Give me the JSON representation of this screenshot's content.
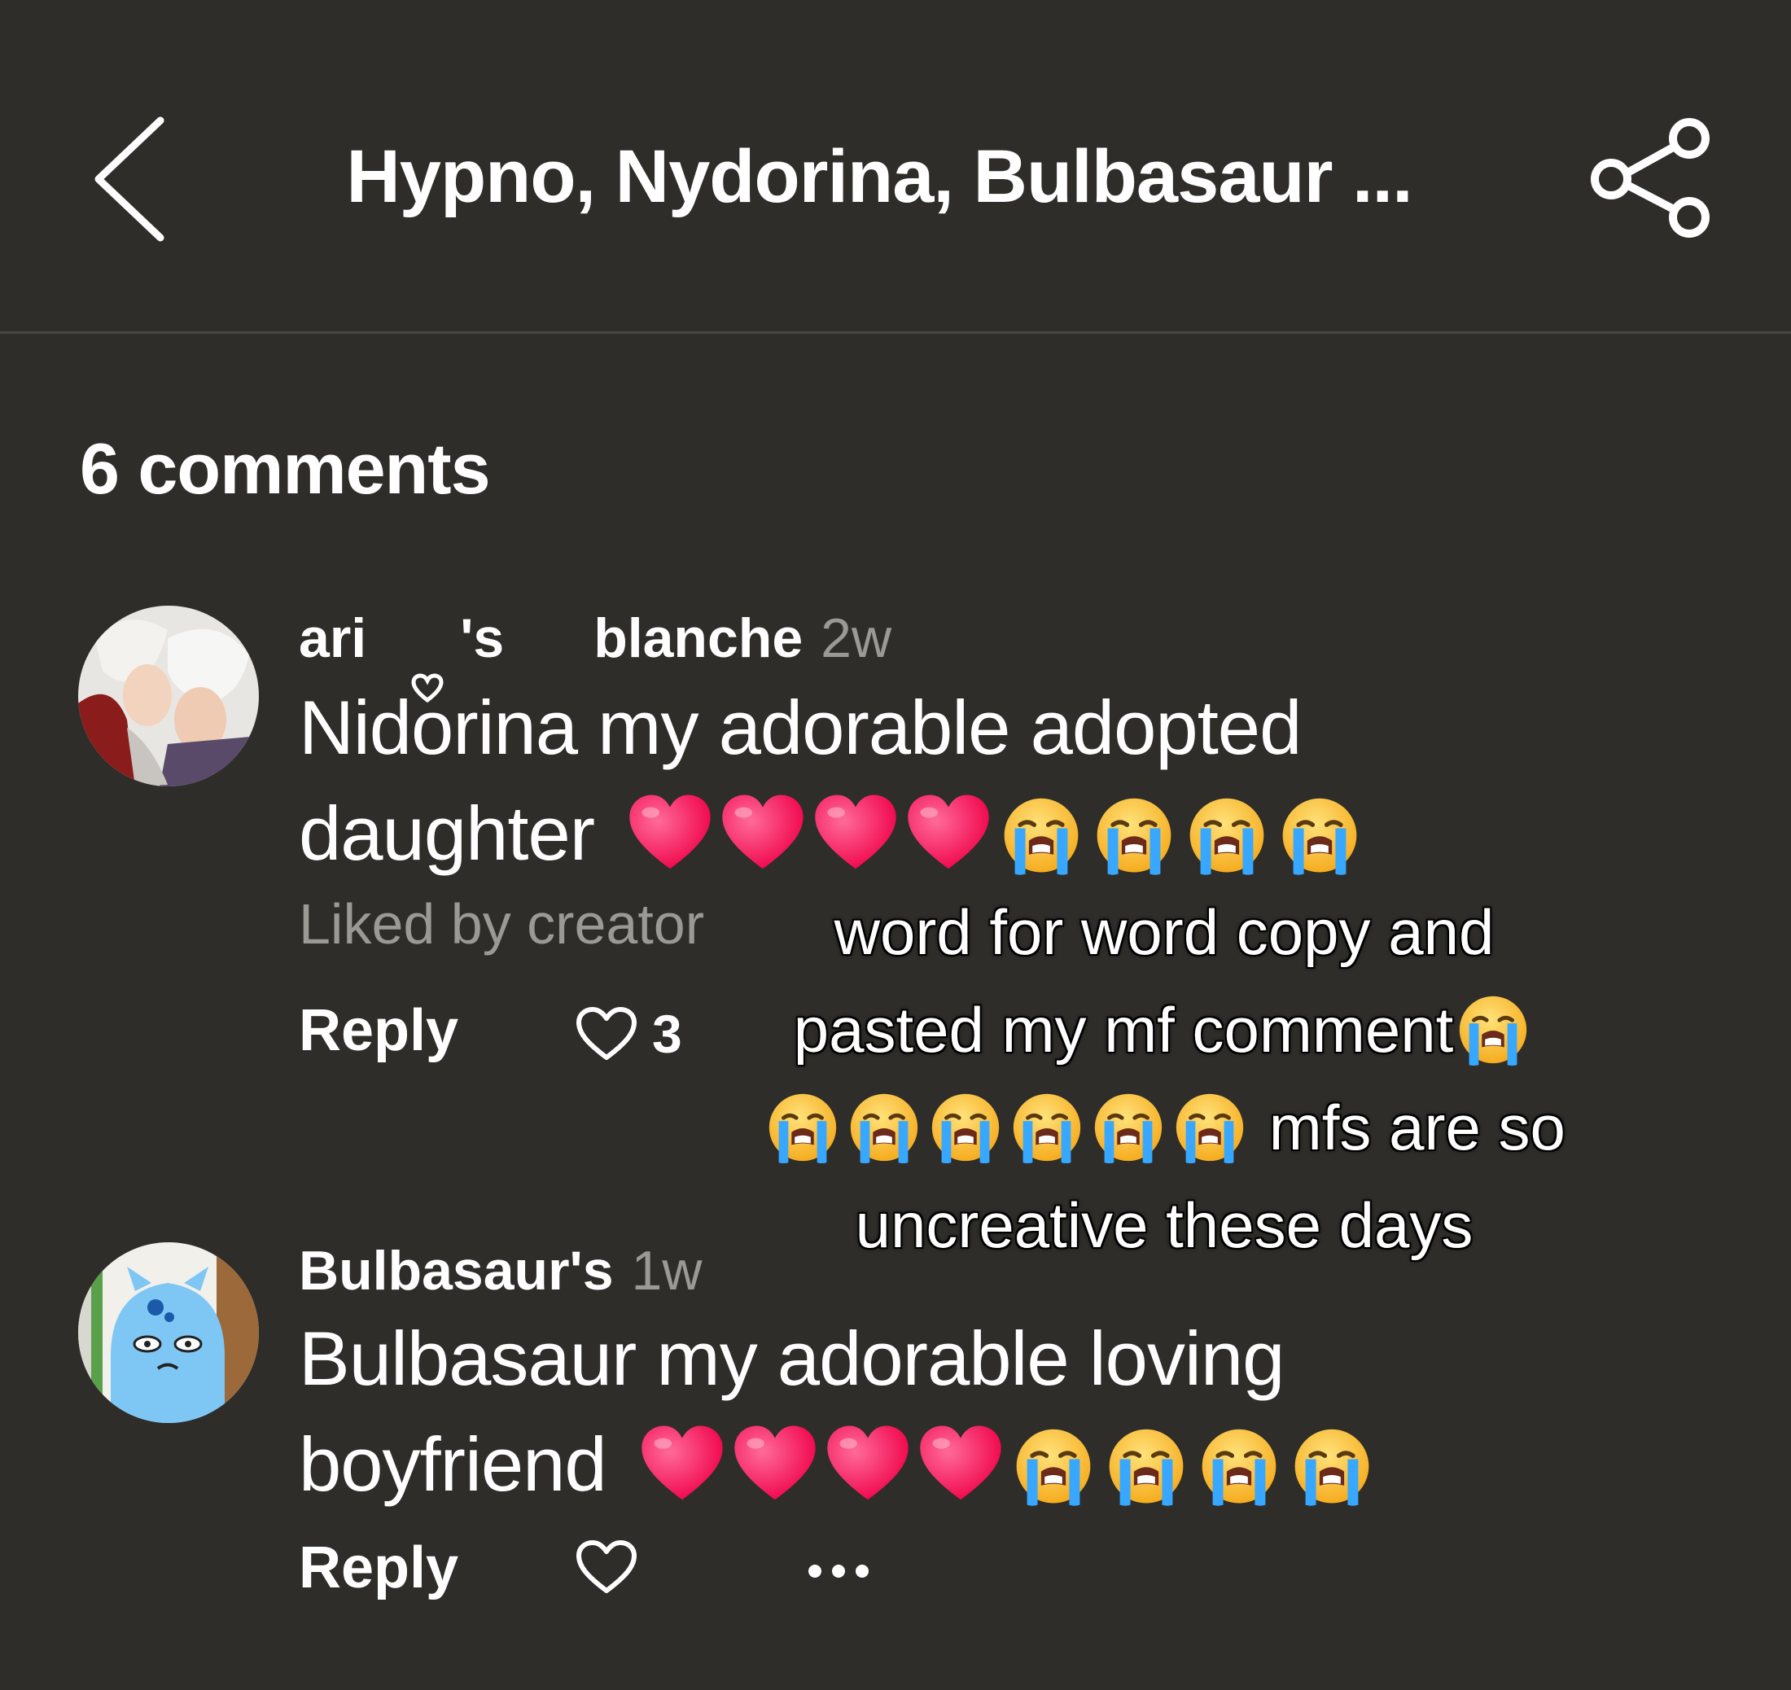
{
  "header": {
    "title": "Hypno, Nydorina, Bulbasaur ..."
  },
  "comments_count": "6 comments",
  "comments": [
    {
      "author_part1": "ari",
      "author_part2": "'s",
      "author_part3": "blanche",
      "time": "2w",
      "line1": "Nidorina my adorable adopted",
      "line2": "daughter",
      "liked_by": "Liked by creator",
      "reply_label": "Reply",
      "likes": "3"
    },
    {
      "author": "Bulbasaur's",
      "time": "1w",
      "line1": "Bulbasaur my adorable loving",
      "line2": "boyfriend",
      "reply_label": "Reply"
    }
  ],
  "caption": {
    "line1": "word for word copy and",
    "line2": "pasted my mf comment",
    "line3": "mfs are so",
    "line4": "uncreative these days"
  },
  "icons": {
    "back": "chevron-left-icon",
    "share": "share-icon",
    "like": "heart-outline-icon",
    "more": "more-dots-icon",
    "heart_emoji": "red-heart-emoji",
    "crying_emoji": "loudly-crying-emoji"
  },
  "colors": {
    "background": "#2e2d2a",
    "muted_text": "#9a9993",
    "heart": "#ff1a5c",
    "emoji_face": "#ffc83d",
    "tears": "#38a7ff"
  }
}
